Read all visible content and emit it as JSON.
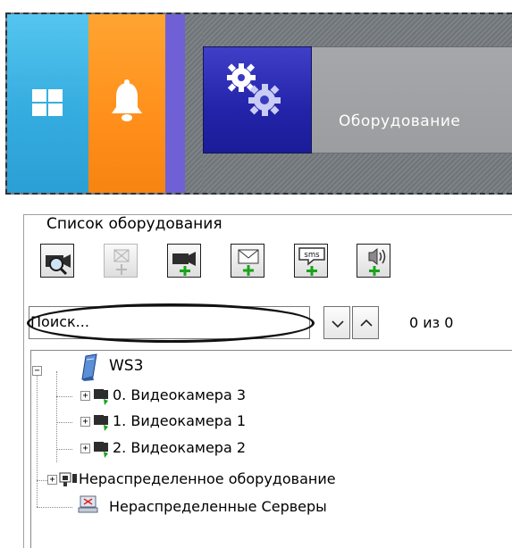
{
  "topbar": {
    "windows_tile": {
      "icon": "windows-icon"
    },
    "notifications_tile": {
      "icon": "bell-icon"
    },
    "equipment_tile": {
      "icon": "gears-icon",
      "label": "Оборудование"
    }
  },
  "panel": {
    "title": "Список оборудования",
    "toolbar": [
      {
        "name": "search-camera-button",
        "icon": "camera-search-icon",
        "enabled": true
      },
      {
        "name": "add-disabled-button",
        "icon": "add-generic-icon",
        "enabled": false
      },
      {
        "name": "add-camera-button",
        "icon": "camera-add-icon",
        "enabled": true
      },
      {
        "name": "add-email-button",
        "icon": "email-add-icon",
        "enabled": true
      },
      {
        "name": "add-sms-button",
        "icon": "sms-add-icon",
        "enabled": true
      },
      {
        "name": "add-audio-button",
        "icon": "speaker-add-icon",
        "enabled": true
      }
    ],
    "search": {
      "placeholder": "Поиск...",
      "count": "0 из 0"
    }
  },
  "tree": {
    "root": {
      "label": "WS3",
      "icon": "server-icon",
      "expanded": true
    },
    "cameras": [
      {
        "label": "0. Видеокамера 3"
      },
      {
        "label": "1. Видеокамера 1"
      },
      {
        "label": "2. Видеокамера 2"
      }
    ],
    "unassigned_equipment": {
      "label": "Нераспределенное оборудование"
    },
    "unassigned_servers": {
      "label": "Нераспределенные Серверы"
    }
  },
  "colors": {
    "windows_tile": "#35acdf",
    "bell_tile": "#ff8f1a",
    "gear_tile": "#2223a8",
    "equipment_tile": "#9c9da0",
    "add_plus": "#1aa31a"
  }
}
